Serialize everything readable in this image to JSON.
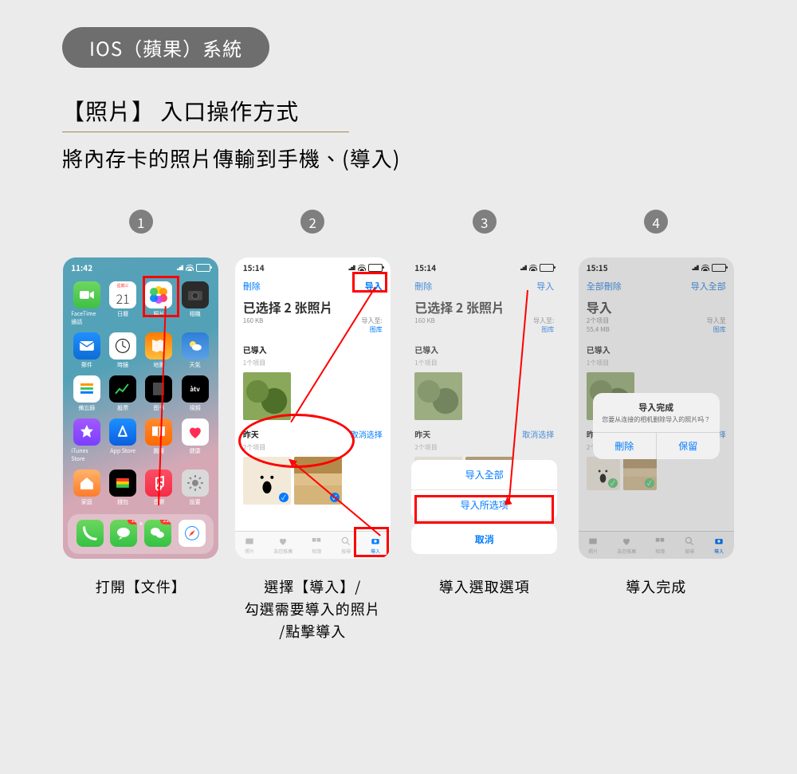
{
  "header": {
    "pill": "IOS（蘋果）系統",
    "title1": "【照片】 入口操作方式",
    "title2": "將內存卡的照片傳輸到手機、(導入)"
  },
  "steps": {
    "s1": {
      "num": "1",
      "caption": "打開【文件】",
      "time": "11:42",
      "apps": {
        "calendar": "21",
        "facetime": "FaceTime 通話",
        "cal_lbl": "日曆",
        "photos": "照片",
        "camera": "相機",
        "mail": "郵件",
        "clock": "時鐘",
        "maps": "地圖",
        "weather": "天氣",
        "reminders": "備忘錄",
        "stocks": "股票",
        "tv": "視頻",
        "tv_txt": "tv",
        "star": "iTunes Store",
        "appstore": "App Store",
        "books": "圖書",
        "health": "健康",
        "home": "家庭",
        "wallet": "錢包",
        "music": "音樂",
        "settings": "設置"
      },
      "badge_msg": "12",
      "badge_wechat": "222"
    },
    "s2": {
      "num": "2",
      "caption_l1": "選擇【導入】/",
      "caption_l2": "勾選需要導入的照片",
      "caption_l3": "/點擊導入",
      "time": "15:14",
      "delete": "刪除",
      "import": "导入",
      "title": "已选择 2 张照片",
      "size": "160 KB",
      "to": "导入至:",
      "to_val": "图库",
      "sec1_title": "已導入",
      "sec1_sub": "1个项目",
      "sec2_title": "昨天",
      "sec2_sub": "2个项目",
      "deselect": "取消选择",
      "tabs": {
        "a": "照片",
        "b": "為您推薦",
        "c": "相簿",
        "d": "搜尋",
        "e": "導入"
      }
    },
    "s3": {
      "num": "3",
      "caption": "導入選取選項",
      "time": "15:14",
      "delete": "刪除",
      "import": "导入",
      "title": "已选择 2 张照片",
      "size": "160 KB",
      "to": "导入至:",
      "to_val": "图库",
      "sec1_title": "已導入",
      "sec1_sub": "1个项目",
      "sec2_title": "昨天",
      "sec2_sub": "2个项目",
      "deselect": "取消选择",
      "sheet": {
        "all": "导入全部",
        "selected": "导入所选项",
        "cancel": "取消"
      }
    },
    "s4": {
      "num": "4",
      "caption": "導入完成",
      "time": "15:15",
      "delete_all": "全部刪除",
      "import_all": "导入全部",
      "title": "导入",
      "size": "2个项目\n55.4 MB",
      "to": "导入至",
      "to_val": "图库",
      "sec1_title": "已導入",
      "sec1_sub": "1个项目",
      "sec2_title": "昨天",
      "sec2_sub": "2个项目",
      "select": "选择",
      "alert": {
        "title": "导入完成",
        "sub": "您要从连接的相机删除导入的照片吗？",
        "delete": "刪除",
        "keep": "保留"
      },
      "tabs": {
        "a": "照片",
        "b": "為您推薦",
        "c": "相簿",
        "d": "搜尋",
        "e": "導入"
      }
    }
  }
}
